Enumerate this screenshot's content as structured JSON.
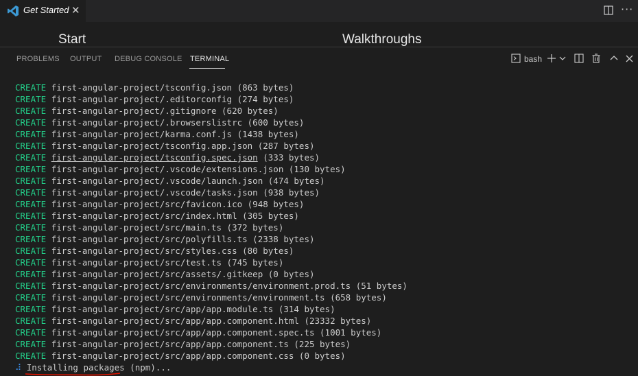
{
  "tab": {
    "title": "Get Started",
    "close_glyph": "✕"
  },
  "editor": {
    "heading_start": "Start",
    "heading_walkthroughs": "Walkthroughs"
  },
  "panel": {
    "tabs": [
      {
        "label": "PROBLEMS"
      },
      {
        "label": "OUTPUT"
      },
      {
        "label": "DEBUG CONSOLE"
      },
      {
        "label": "TERMINAL"
      }
    ],
    "shell": "bash"
  },
  "terminal": {
    "keyword": "CREATE",
    "lines": [
      "first-angular-project/tsconfig.json (863 bytes)",
      "first-angular-project/.editorconfig (274 bytes)",
      "first-angular-project/.gitignore (620 bytes)",
      "first-angular-project/.browserslistrc (600 bytes)",
      "first-angular-project/karma.conf.js (1438 bytes)",
      "first-angular-project/tsconfig.app.json (287 bytes)",
      "first-angular-project/tsconfig.spec.json (333 bytes)",
      "first-angular-project/.vscode/extensions.json (130 bytes)",
      "first-angular-project/.vscode/launch.json (474 bytes)",
      "first-angular-project/.vscode/tasks.json (938 bytes)",
      "first-angular-project/src/favicon.ico (948 bytes)",
      "first-angular-project/src/index.html (305 bytes)",
      "first-angular-project/src/main.ts (372 bytes)",
      "first-angular-project/src/polyfills.ts (2338 bytes)",
      "first-angular-project/src/styles.css (80 bytes)",
      "first-angular-project/src/test.ts (745 bytes)",
      "first-angular-project/src/assets/.gitkeep (0 bytes)",
      "first-angular-project/src/environments/environment.prod.ts (51 bytes)",
      "first-angular-project/src/environments/environment.ts (658 bytes)",
      "first-angular-project/src/app/app.module.ts (314 bytes)",
      "first-angular-project/src/app/app.component.html (23332 bytes)",
      "first-angular-project/src/app/app.component.spec.ts (1001 bytes)",
      "first-angular-project/src/app/app.component.ts (225 bytes)",
      "first-angular-project/src/app/app.component.css (0 bytes)"
    ],
    "status": {
      "spinner": "⠼",
      "text_underlined": "Installing packages",
      "text_rest": " (npm)..."
    }
  },
  "colors": {
    "keyword": "#23d18b",
    "annotation": "#e51400",
    "vscode_blue": "#3c99d4"
  }
}
